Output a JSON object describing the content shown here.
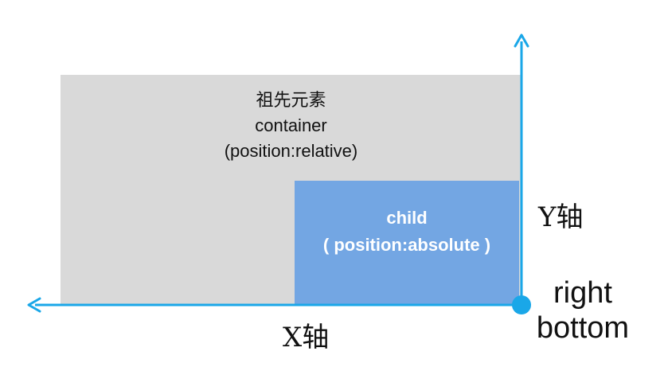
{
  "container": {
    "line1": "祖先元素",
    "line2": "container",
    "line3": "(position:relative)",
    "color": "#d9d9d9"
  },
  "child": {
    "line1": "child",
    "line2": "( position:absolute )",
    "color": "#73a6e3"
  },
  "axes": {
    "x_label": "X轴",
    "y_label": "Y轴",
    "color": "#1aa7e8"
  },
  "corner": {
    "line1": "right",
    "line2": "bottom"
  }
}
